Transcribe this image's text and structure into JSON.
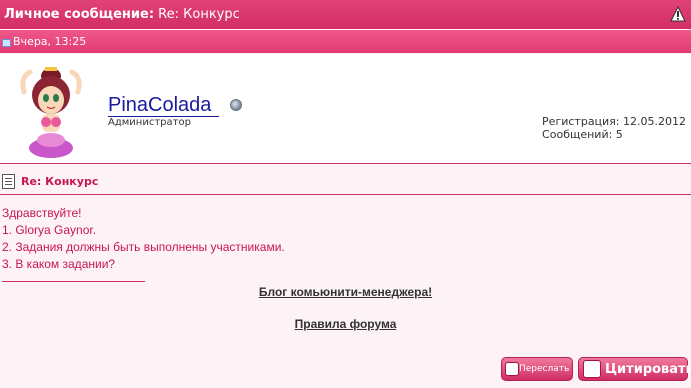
{
  "header": {
    "title_prefix": "Личное сообщение:",
    "title_subject": "Re: Конкурс",
    "warn_icon": "warning-icon"
  },
  "post_date": "Вчера, 13:25",
  "author": {
    "name": "PinaColada",
    "role": "Администратор",
    "registration": "Регистрация: 12.05.2012",
    "messages": "Сообщений: 5"
  },
  "subject": "Re: Конкурс",
  "message_lines": [
    "Здравствуйте!",
    "1. Glorya Gaynor.",
    "2. Задания должны быть выполнены участниками.",
    "3. В каком задании?"
  ],
  "signature": {
    "link1": "Блог комьюнити-менеджера!",
    "link2": "Правила форума"
  },
  "buttons": {
    "forward": "Переслать",
    "quote": "Цитировать"
  },
  "colors": {
    "accent": "#d42d66",
    "text_accent": "#c8174f",
    "link": "#1a1aa0"
  }
}
